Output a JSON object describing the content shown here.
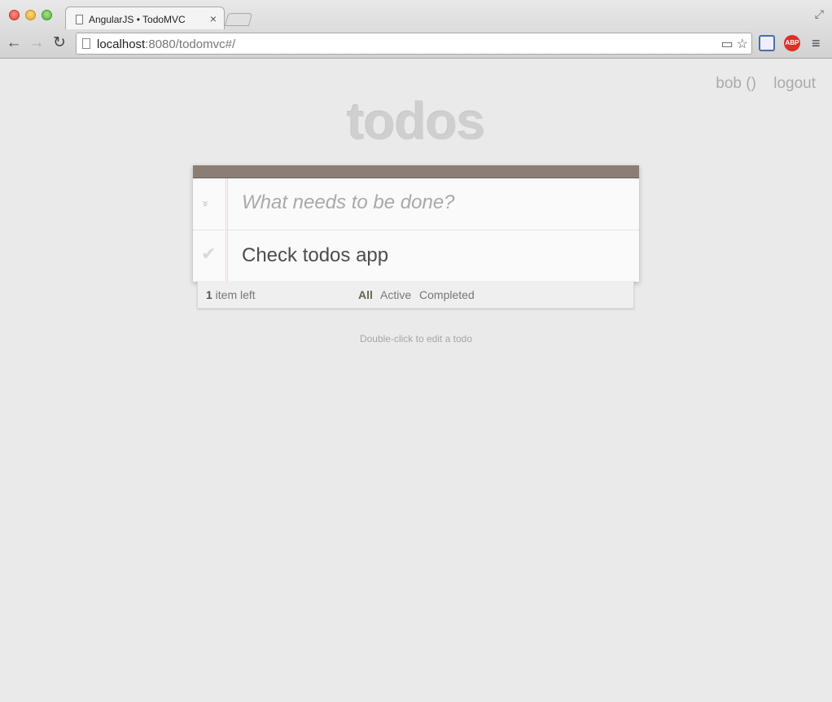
{
  "browser": {
    "tab_title": "AngularJS • TodoMVC",
    "tab_close": "×",
    "url_host": "localhost",
    "url_rest": ":8080/todomvc#/",
    "back_glyph": "←",
    "forward_glyph": "→",
    "reload_glyph": "↻",
    "abp_label": "ABP",
    "menu_glyph": "≡"
  },
  "user": {
    "name": "bob ()",
    "logout": "logout"
  },
  "app": {
    "title": "todos",
    "new_todo_placeholder": "What needs to be done?",
    "toggle_all_glyph": "»",
    "todos": [
      {
        "title": "Check todos app",
        "check_glyph": "✔"
      }
    ]
  },
  "footer": {
    "count": "1",
    "count_suffix": " item left",
    "filters": [
      "All",
      "Active",
      "Completed"
    ],
    "selected_filter": "All"
  },
  "info": "Double-click to edit a todo"
}
